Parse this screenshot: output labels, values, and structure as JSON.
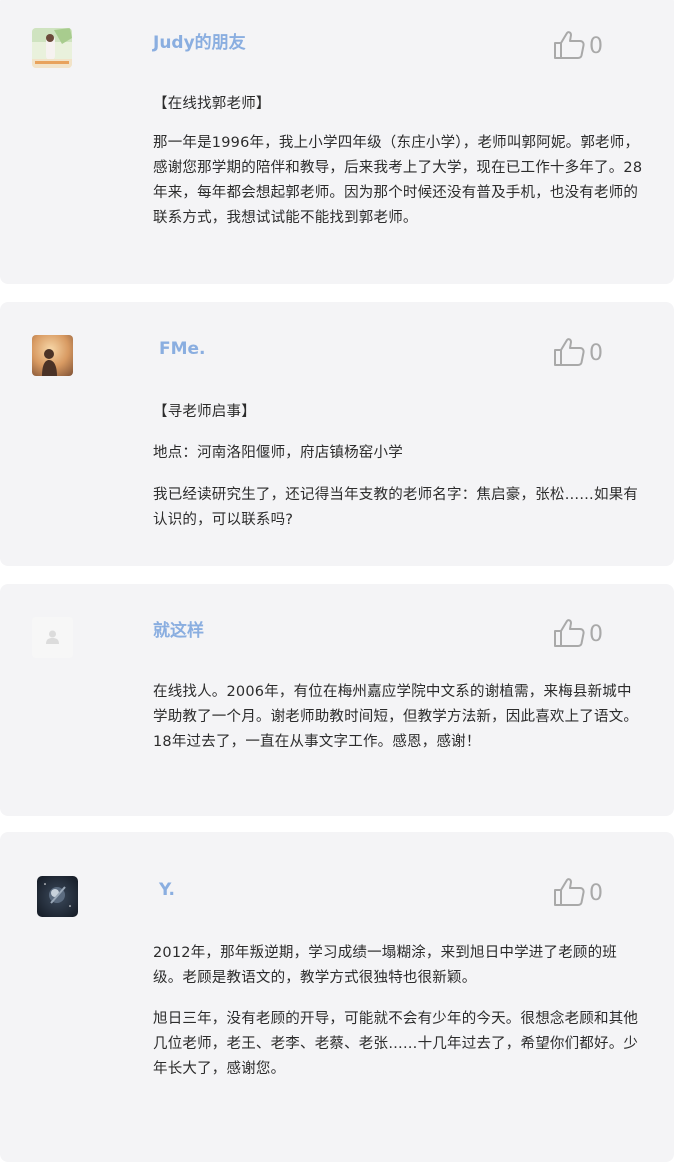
{
  "comments": [
    {
      "username": "Judy的朋友",
      "likes": "0",
      "paragraphs": [
        "【在线找郭老师】",
        "那一年是1996年，我上小学四年级（东庄小学），老师叫郭阿妮。郭老师，感谢您那学期的陪伴和教导，后来我考上了大学，现在已工作十多年了。28年来，每年都会想起郭老师。因为那个时候还没有普及手机，也没有老师的联系方式，我想试试能不能找到郭老师。"
      ]
    },
    {
      "username": "FMe.",
      "likes": "0",
      "paragraphs": [
        "【寻老师启事】",
        "地点：河南洛阳偃师，府店镇杨窑小学",
        "我已经读研究生了，还记得当年支教的老师名字：焦启豪，张松……如果有认识的，可以联系吗?"
      ]
    },
    {
      "username": "就这样",
      "likes": "0",
      "paragraphs": [
        "在线找人。2006年，有位在梅州嘉应学院中文系的谢植需，来梅县新城中学助教了一个月。谢老师助教时间短，但教学方法新，因此喜欢上了语文。18年过去了，一直在从事文字工作。感恩，感谢！"
      ]
    },
    {
      "username": "Y.",
      "likes": "0",
      "paragraphs": [
        "2012年，那年叛逆期，学习成绩一塌糊涂，来到旭日中学进了老顾的班级。老顾是教语文的，教学方式很独特也很新颖。",
        "旭日三年，没有老顾的开导，可能就不会有少年的今天。很想念老顾和其他几位老师，老王、老李、老蔡、老张……十几年过去了，希望你们都好。少年长大了，感谢您。"
      ]
    }
  ],
  "icons": {
    "like": "thumbs-up-icon",
    "default_avatar": "user-silhouette-icon"
  },
  "colors": {
    "card_bg": "#f4f4f6",
    "username": "#8aaee0",
    "body_text": "#2c2c2c",
    "like_icon": "#a9a9a9"
  }
}
